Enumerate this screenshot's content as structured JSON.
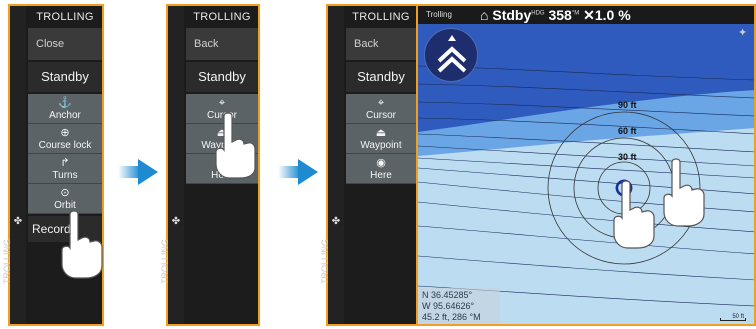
{
  "panel1": {
    "header": "TROLLING",
    "top": "Close",
    "mode": "Standby",
    "items": [
      {
        "icon": "anchor-icon",
        "glyph": "⚓",
        "label": "Anchor"
      },
      {
        "icon": "course-lock-icon",
        "glyph": "⊕",
        "label": "Course lock"
      },
      {
        "icon": "turns-icon",
        "glyph": "↱",
        "label": "Turns"
      },
      {
        "icon": "orbit-icon",
        "glyph": "⊙",
        "label": "Orbit"
      }
    ],
    "record": "Record",
    "rail_label": "TROLLING"
  },
  "panel2": {
    "header": "TROLLING",
    "top": "Back",
    "mode": "Standby",
    "items": [
      {
        "icon": "cursor-icon",
        "glyph": "⌖",
        "label": "Cursor"
      },
      {
        "icon": "waypoint-icon",
        "glyph": "⏏",
        "label": "Waypoint"
      },
      {
        "icon": "here-icon",
        "glyph": "◉",
        "label": "Here"
      }
    ],
    "rail_label": "TROLLING"
  },
  "panel3": {
    "header": "TROLLING",
    "top": "Back",
    "mode": "Standby",
    "items": [
      {
        "icon": "cursor-icon",
        "glyph": "⌖",
        "label": "Cursor"
      },
      {
        "icon": "waypoint-icon",
        "glyph": "⏏",
        "label": "Waypoint"
      },
      {
        "icon": "here-icon",
        "glyph": "◉",
        "label": "Here"
      }
    ],
    "rail_label": "TROLLING"
  },
  "map": {
    "mode": "Trolling",
    "stdby": "Stdby",
    "hdg_label": "HDG",
    "heading": "358",
    "unit_tm": "°M",
    "speed": "1.0 %",
    "coords": [
      "N  36.45285°",
      "W  95.64626°",
      "45.2 ft, 286 °M"
    ],
    "depths": [
      "90 ft",
      "60 ft",
      "30 ft"
    ],
    "scale": "50 ft",
    "colors": {
      "deep": "#2e5bbd",
      "mid": "#6aa6e6",
      "shallow": "#bcdcf2",
      "panel_border": "#f0a020",
      "arrow": "#1e8bd1"
    }
  }
}
